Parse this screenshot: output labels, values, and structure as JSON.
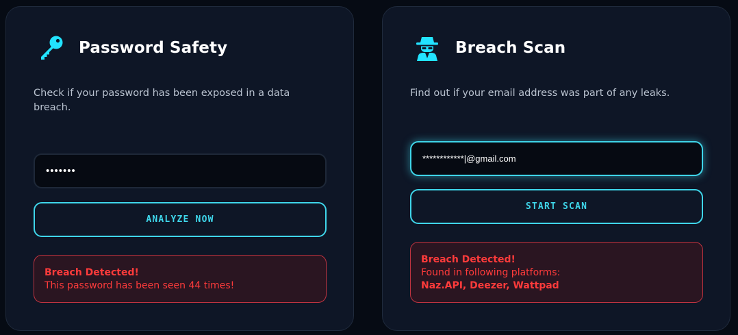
{
  "password_card": {
    "icon": "key-icon",
    "title": "Password Safety",
    "description": "Check if your password has been exposed in a data breach.",
    "input_value": "•••••••",
    "button_label": "ANALYZE NOW",
    "alert": {
      "heading": "Breach Detected!",
      "message": "This password has been seen 44 times!"
    }
  },
  "breach_card": {
    "icon": "spy-icon",
    "title": "Breach Scan",
    "description": "Find out if your email address was part of any leaks.",
    "input_value": "************|@gmail.com",
    "button_label": "START SCAN",
    "alert": {
      "heading": "Breach Detected!",
      "message": "Found in following platforms:",
      "platforms": "Naz.API, Deezer, Wattpad"
    }
  },
  "colors": {
    "accent": "#3fd6ea",
    "alert_red": "#ff3b3b",
    "card_bg": "#0e1626",
    "page_bg": "#060b14"
  }
}
